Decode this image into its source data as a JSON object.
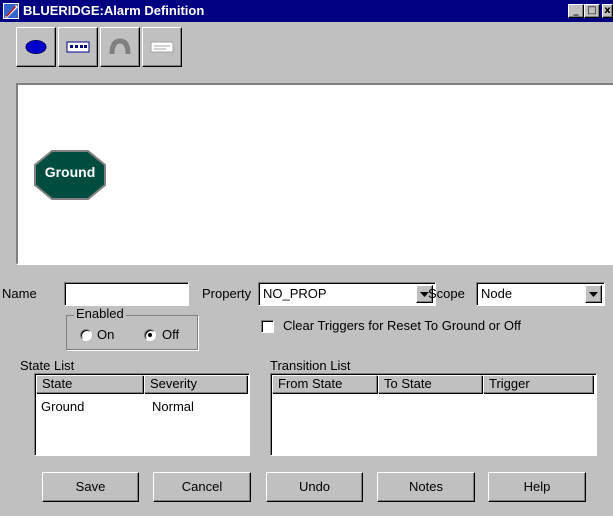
{
  "window": {
    "title": "BLUERIDGE:Alarm Definition",
    "controls": {
      "minimize": "_",
      "maximize": "□",
      "close": "x"
    }
  },
  "toolbar": {
    "tools": [
      {
        "icon": "ellipse-state-icon"
      },
      {
        "icon": "rectangle-state-icon"
      },
      {
        "icon": "arc-transition-icon"
      },
      {
        "icon": "trigger-tool-icon"
      }
    ]
  },
  "canvas": {
    "nodes": [
      {
        "label": "Ground",
        "shape": "octagon",
        "fill": "#004d40"
      }
    ]
  },
  "form": {
    "name_label": "Name",
    "name_value": "",
    "property_label": "Property",
    "property_value": "NO_PROP",
    "scope_label": "Scope",
    "scope_value": "Node",
    "enabled": {
      "title": "Enabled",
      "on_label": "On",
      "off_label": "Off",
      "selected": "Off"
    },
    "clear_triggers": {
      "label": "Clear Triggers for Reset To Ground or Off",
      "checked": false
    }
  },
  "state_list": {
    "title": "State List",
    "columns": [
      "State",
      "Severity"
    ],
    "rows": [
      [
        "Ground",
        "Normal"
      ]
    ]
  },
  "transition_list": {
    "title": "Transition List",
    "columns": [
      "From State",
      "To State",
      "Trigger"
    ],
    "rows": []
  },
  "buttons": {
    "save": "Save",
    "cancel": "Cancel",
    "undo": "Undo",
    "notes": "Notes",
    "help": "Help"
  },
  "colors": {
    "titlebar": "#000080",
    "face": "#c0c0c0",
    "state_fill": "#004d40"
  }
}
